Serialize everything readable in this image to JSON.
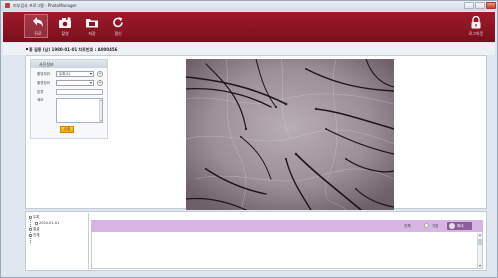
{
  "window": {
    "title": "피부검사 프로그램 - PhotoManager"
  },
  "toolbar": {
    "back_label": "뒤로",
    "photo_label": "촬영",
    "save_label": "저장",
    "refresh_label": "갱신",
    "logout_label": "로그아웃"
  },
  "patient": {
    "info": "홍 길동 (남) 1980-01-01  차트번호 : A000456"
  },
  "photo_info": {
    "header": "사진정보",
    "position_label": "촬영부위",
    "position_value": "두피(1)",
    "device_label": "촬영장비",
    "device_value": "",
    "region_label": "분류",
    "memo_label": "메모",
    "modify_button": "수정"
  },
  "tree": {
    "items": [
      {
        "label": "두피"
      },
      {
        "label": "2024-01-01"
      },
      {
        "label": "얼굴"
      },
      {
        "label": "전체"
      }
    ]
  },
  "detail": {
    "all_label": "전체",
    "option_label": "기본",
    "segment_label": "확대"
  },
  "colors": {
    "toolbar": "#8b1424",
    "segment": "#8a5c9c",
    "detail_header": "#d7b6e3",
    "modify_button": "#f0a400"
  }
}
